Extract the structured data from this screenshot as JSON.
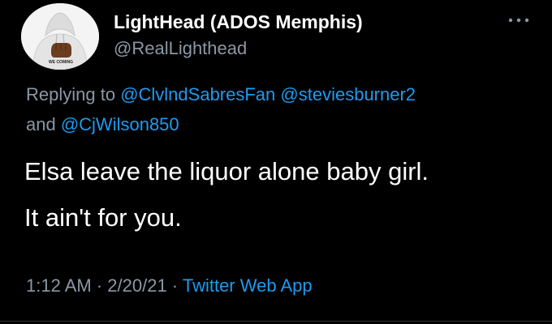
{
  "tweet": {
    "author": {
      "display_name": "LightHead (ADOS Memphis)",
      "handle": "@RealLighthead",
      "avatar_text": "WE COMING",
      "avatar_icon": "fist-hoodie-avatar"
    },
    "more_icon": "more-horizontal-icon",
    "replying_to": {
      "prefix": "Replying to ",
      "mentions": [
        "@ClvlndSabresFan",
        "@steviesburner2",
        "@CjWilson850"
      ],
      "joiner": "and "
    },
    "body_lines": [
      "Elsa leave the liquor alone baby girl.",
      "It ain't for you."
    ],
    "timestamp": {
      "time": "1:12 AM",
      "separator": " · ",
      "date": "2/20/21",
      "source": "Twitter Web App"
    }
  },
  "colors": {
    "background": "#000000",
    "text_primary": "#ffffff",
    "text_secondary": "#8b98a5",
    "accent": "#1d9bf0"
  }
}
